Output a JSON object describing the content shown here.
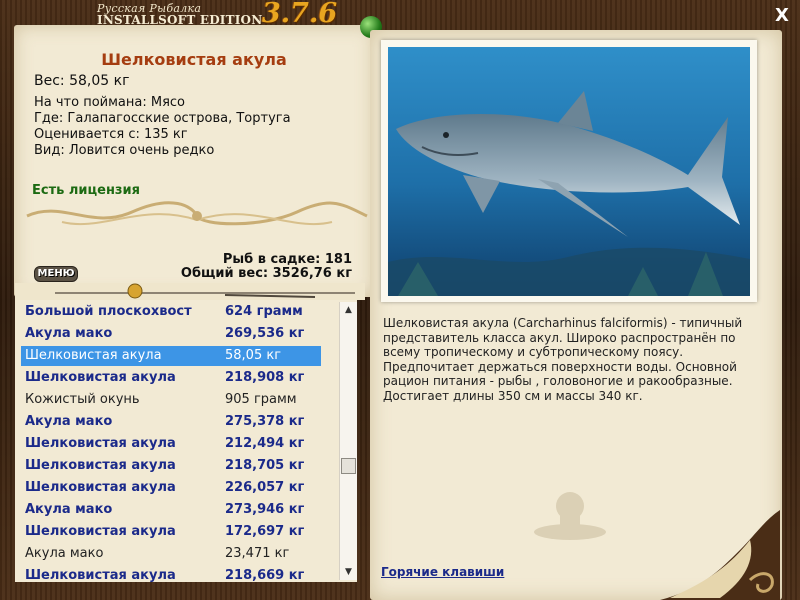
{
  "app": {
    "logo_line1": "Русская Рыбалка",
    "logo_line2": "INSTALLSOFT EDITION",
    "version": "3.7.6",
    "close_label": "X"
  },
  "fish": {
    "name": "Шелковистая акула",
    "weight": "Вес: 58,05 кг",
    "bait": "На что поймана: Мясо",
    "location": "Где: Галапагосские острова, Тортуга",
    "value": "Оценивается с: 135 кг",
    "rarity": "Вид: Ловится очень редко",
    "license": "Есть лицензия"
  },
  "stats": {
    "count": "Рыб в садке: 181",
    "total_weight": "Общий вес: 3526,76 кг"
  },
  "menu_label": "МЕНЮ",
  "catch_list": [
    {
      "name": "Большой плоскохвост",
      "weight": "624 грамм",
      "style": "bold"
    },
    {
      "name": "Акула мако",
      "weight": "269,536 кг",
      "style": "bold"
    },
    {
      "name": "Шелковистая акула",
      "weight": "58,05 кг",
      "style": "selected"
    },
    {
      "name": "Шелковистая акула",
      "weight": "218,908 кг",
      "style": "bold"
    },
    {
      "name": "Кожистый окунь",
      "weight": "905 грамм",
      "style": "plain"
    },
    {
      "name": "Акула мако",
      "weight": "275,378 кг",
      "style": "bold"
    },
    {
      "name": "Шелковистая акула",
      "weight": "212,494 кг",
      "style": "bold"
    },
    {
      "name": "Шелковистая акула",
      "weight": "218,705 кг",
      "style": "bold"
    },
    {
      "name": "Шелковистая акула",
      "weight": "226,057 кг",
      "style": "bold"
    },
    {
      "name": "Акула мако",
      "weight": "273,946 кг",
      "style": "bold"
    },
    {
      "name": "Шелковистая акула",
      "weight": "172,697 кг",
      "style": "bold"
    },
    {
      "name": "Акула мако",
      "weight": "23,471 кг",
      "style": "plain"
    },
    {
      "name": "Шелковистая акула",
      "weight": "218,669 кг",
      "style": "bold"
    }
  ],
  "description": "Шелковистая акула (Carcharhinus falciformis) - типичный представитель класса акул. Широко распространён по всему тропическому и субтропическому поясу. Предпочитает держаться поверхности воды. Основной рацион питания - рыбы , головоногие и ракообразные. Достигает длины 350 см и массы 340 кг.",
  "hotkeys_label": "Горячие клавиши",
  "colors": {
    "title": "#a53d10",
    "license": "#1c6a12",
    "list_bold": "#1b2a8a",
    "selection": "#3d95e6",
    "parchment": "#f2ead4",
    "version": "#e8a520"
  }
}
